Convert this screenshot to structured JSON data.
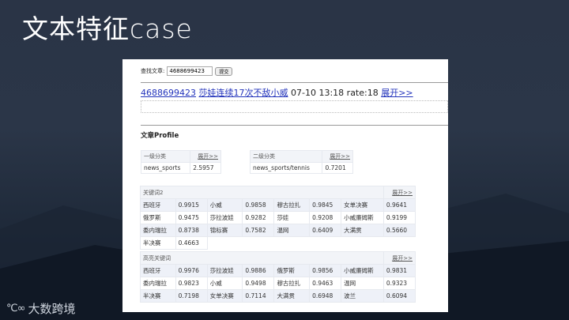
{
  "slide": {
    "title": "文本特征case",
    "logo_text": "大数跨境"
  },
  "search": {
    "label": "查找文章:",
    "value": "4688699423",
    "submit": "提交"
  },
  "article": {
    "id": "4688699423",
    "title": "莎娃连续17次不敌小威",
    "time": "07-10 13:18",
    "rate": "rate:18",
    "expand": "展开>>"
  },
  "profile": {
    "heading": "文章Profile",
    "cat1": {
      "header": "一级分类",
      "expand": "展开>>",
      "name": "news_sports",
      "score": "2.5957"
    },
    "cat2": {
      "header": "二级分类",
      "expand": "展开>>",
      "name": "news_sports/tennis",
      "score": "0.7201"
    }
  },
  "keywords2": {
    "header": "关键词2",
    "expand": "展开>>",
    "rows": [
      [
        [
          "西班牙",
          "0.9915"
        ],
        [
          "小威",
          "0.9858"
        ],
        [
          "穆古拉扎",
          "0.9845"
        ],
        [
          "女单决赛",
          "0.9641"
        ]
      ],
      [
        [
          "俄罗斯",
          "0.9475"
        ],
        [
          "莎拉波娃",
          "0.9282"
        ],
        [
          "莎娃",
          "0.9208"
        ],
        [
          "小威廉姆斯",
          "0.9199"
        ]
      ],
      [
        [
          "委内瑞拉",
          "0.8738"
        ],
        [
          "锦标赛",
          "0.7582"
        ],
        [
          "温网",
          "0.6409"
        ],
        [
          "大满贯",
          "0.5660"
        ]
      ],
      [
        [
          "半决赛",
          "0.4663"
        ]
      ]
    ]
  },
  "highlight": {
    "header": "高亮关键词",
    "expand": "展开>>",
    "rows": [
      [
        [
          "西班牙",
          "0.9976"
        ],
        [
          "莎拉波娃",
          "0.9886"
        ],
        [
          "俄罗斯",
          "0.9856"
        ],
        [
          "小威廉姆斯",
          "0.9831"
        ]
      ],
      [
        [
          "委内瑞拉",
          "0.9823"
        ],
        [
          "小威",
          "0.9498"
        ],
        [
          "穆古拉扎",
          "0.9463"
        ],
        [
          "温网",
          "0.9323"
        ]
      ],
      [
        [
          "半决赛",
          "0.7198"
        ],
        [
          "女单决赛",
          "0.7114"
        ],
        [
          "大满贯",
          "0.6948"
        ],
        [
          "波兰",
          "0.6094"
        ]
      ]
    ]
  }
}
